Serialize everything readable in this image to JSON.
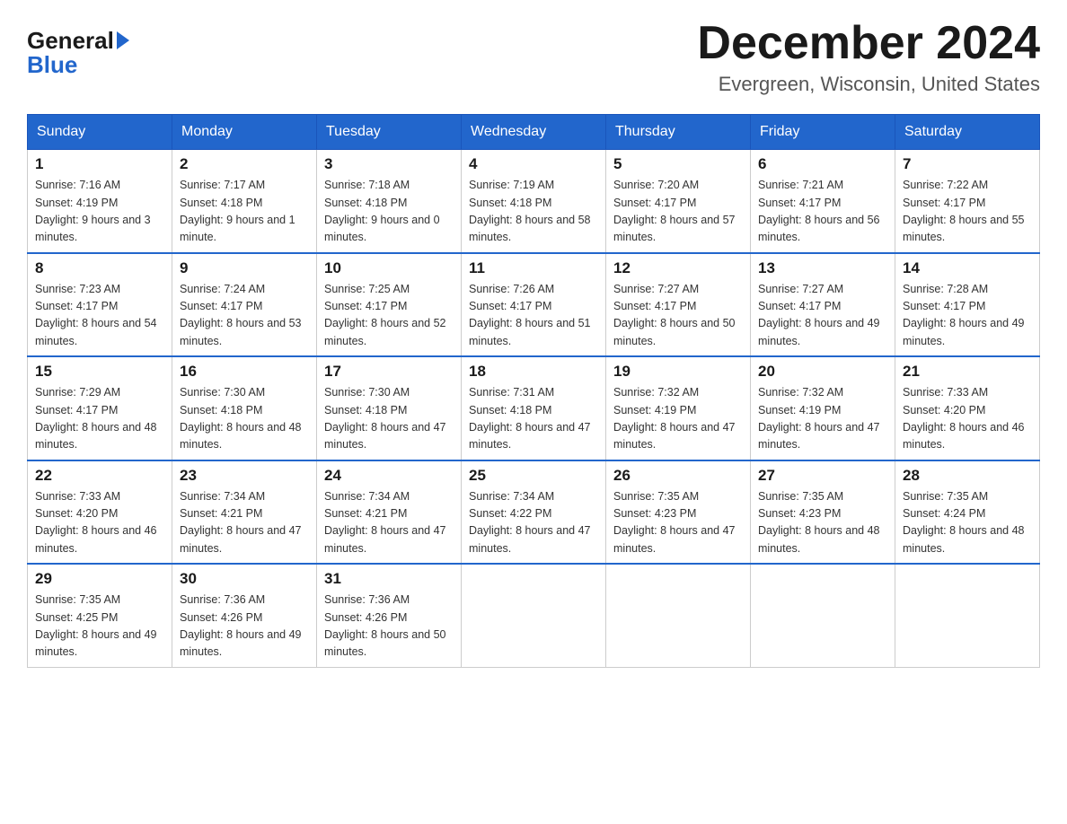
{
  "logo": {
    "general": "General",
    "blue": "Blue"
  },
  "header": {
    "month_year": "December 2024",
    "location": "Evergreen, Wisconsin, United States"
  },
  "days_of_week": [
    "Sunday",
    "Monday",
    "Tuesday",
    "Wednesday",
    "Thursday",
    "Friday",
    "Saturday"
  ],
  "weeks": [
    [
      {
        "date": "1",
        "sunrise": "7:16 AM",
        "sunset": "4:19 PM",
        "daylight": "9 hours and 3 minutes."
      },
      {
        "date": "2",
        "sunrise": "7:17 AM",
        "sunset": "4:18 PM",
        "daylight": "9 hours and 1 minute."
      },
      {
        "date": "3",
        "sunrise": "7:18 AM",
        "sunset": "4:18 PM",
        "daylight": "9 hours and 0 minutes."
      },
      {
        "date": "4",
        "sunrise": "7:19 AM",
        "sunset": "4:18 PM",
        "daylight": "8 hours and 58 minutes."
      },
      {
        "date": "5",
        "sunrise": "7:20 AM",
        "sunset": "4:17 PM",
        "daylight": "8 hours and 57 minutes."
      },
      {
        "date": "6",
        "sunrise": "7:21 AM",
        "sunset": "4:17 PM",
        "daylight": "8 hours and 56 minutes."
      },
      {
        "date": "7",
        "sunrise": "7:22 AM",
        "sunset": "4:17 PM",
        "daylight": "8 hours and 55 minutes."
      }
    ],
    [
      {
        "date": "8",
        "sunrise": "7:23 AM",
        "sunset": "4:17 PM",
        "daylight": "8 hours and 54 minutes."
      },
      {
        "date": "9",
        "sunrise": "7:24 AM",
        "sunset": "4:17 PM",
        "daylight": "8 hours and 53 minutes."
      },
      {
        "date": "10",
        "sunrise": "7:25 AM",
        "sunset": "4:17 PM",
        "daylight": "8 hours and 52 minutes."
      },
      {
        "date": "11",
        "sunrise": "7:26 AM",
        "sunset": "4:17 PM",
        "daylight": "8 hours and 51 minutes."
      },
      {
        "date": "12",
        "sunrise": "7:27 AM",
        "sunset": "4:17 PM",
        "daylight": "8 hours and 50 minutes."
      },
      {
        "date": "13",
        "sunrise": "7:27 AM",
        "sunset": "4:17 PM",
        "daylight": "8 hours and 49 minutes."
      },
      {
        "date": "14",
        "sunrise": "7:28 AM",
        "sunset": "4:17 PM",
        "daylight": "8 hours and 49 minutes."
      }
    ],
    [
      {
        "date": "15",
        "sunrise": "7:29 AM",
        "sunset": "4:17 PM",
        "daylight": "8 hours and 48 minutes."
      },
      {
        "date": "16",
        "sunrise": "7:30 AM",
        "sunset": "4:18 PM",
        "daylight": "8 hours and 48 minutes."
      },
      {
        "date": "17",
        "sunrise": "7:30 AM",
        "sunset": "4:18 PM",
        "daylight": "8 hours and 47 minutes."
      },
      {
        "date": "18",
        "sunrise": "7:31 AM",
        "sunset": "4:18 PM",
        "daylight": "8 hours and 47 minutes."
      },
      {
        "date": "19",
        "sunrise": "7:32 AM",
        "sunset": "4:19 PM",
        "daylight": "8 hours and 47 minutes."
      },
      {
        "date": "20",
        "sunrise": "7:32 AM",
        "sunset": "4:19 PM",
        "daylight": "8 hours and 47 minutes."
      },
      {
        "date": "21",
        "sunrise": "7:33 AM",
        "sunset": "4:20 PM",
        "daylight": "8 hours and 46 minutes."
      }
    ],
    [
      {
        "date": "22",
        "sunrise": "7:33 AM",
        "sunset": "4:20 PM",
        "daylight": "8 hours and 46 minutes."
      },
      {
        "date": "23",
        "sunrise": "7:34 AM",
        "sunset": "4:21 PM",
        "daylight": "8 hours and 47 minutes."
      },
      {
        "date": "24",
        "sunrise": "7:34 AM",
        "sunset": "4:21 PM",
        "daylight": "8 hours and 47 minutes."
      },
      {
        "date": "25",
        "sunrise": "7:34 AM",
        "sunset": "4:22 PM",
        "daylight": "8 hours and 47 minutes."
      },
      {
        "date": "26",
        "sunrise": "7:35 AM",
        "sunset": "4:23 PM",
        "daylight": "8 hours and 47 minutes."
      },
      {
        "date": "27",
        "sunrise": "7:35 AM",
        "sunset": "4:23 PM",
        "daylight": "8 hours and 48 minutes."
      },
      {
        "date": "28",
        "sunrise": "7:35 AM",
        "sunset": "4:24 PM",
        "daylight": "8 hours and 48 minutes."
      }
    ],
    [
      {
        "date": "29",
        "sunrise": "7:35 AM",
        "sunset": "4:25 PM",
        "daylight": "8 hours and 49 minutes."
      },
      {
        "date": "30",
        "sunrise": "7:36 AM",
        "sunset": "4:26 PM",
        "daylight": "8 hours and 49 minutes."
      },
      {
        "date": "31",
        "sunrise": "7:36 AM",
        "sunset": "4:26 PM",
        "daylight": "8 hours and 50 minutes."
      },
      null,
      null,
      null,
      null
    ]
  ]
}
